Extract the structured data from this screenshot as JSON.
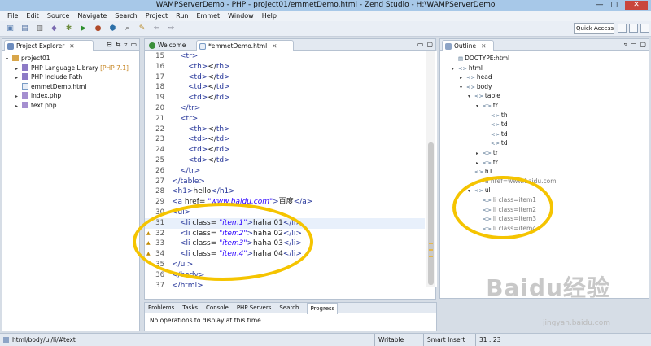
{
  "window": {
    "title": "WAMPServerDemo - PHP - project01/emmetDemo.html - Zend Studio - H:\\WAMPServerDemo"
  },
  "menu": [
    "File",
    "Edit",
    "Source",
    "Navigate",
    "Search",
    "Project",
    "Run",
    "Emmet",
    "Window",
    "Help"
  ],
  "toolbar": {
    "quick_access": "Quick Access"
  },
  "project_explorer": {
    "tab_label": "Project Explorer",
    "items": [
      {
        "label": "project01",
        "extra": ""
      },
      {
        "label": "PHP Language Library",
        "extra": "[PHP 7.1]"
      },
      {
        "label": "PHP Include Path",
        "extra": ""
      },
      {
        "label": "emmetDemo.html",
        "extra": ""
      },
      {
        "label": "index.php",
        "extra": ""
      },
      {
        "label": "text.php",
        "extra": ""
      }
    ]
  },
  "editor": {
    "tabs": [
      {
        "label": "Welcome"
      },
      {
        "label": "*emmetDemo.html"
      }
    ],
    "lines": [
      {
        "num": "15",
        "code": [
          [
            "t",
            "<tr>"
          ]
        ],
        "indent": 1
      },
      {
        "num": "16",
        "code": [
          [
            "t",
            "<th>"
          ],
          [
            "a",
            "</"
          ],
          [
            "t",
            "th>"
          ]
        ],
        "indent": 2
      },
      {
        "num": "17",
        "code": [
          [
            "t",
            "<td>"
          ],
          [
            "a",
            "</"
          ],
          [
            "t",
            "td>"
          ]
        ],
        "indent": 2
      },
      {
        "num": "18",
        "code": [
          [
            "t",
            "<td>"
          ],
          [
            "a",
            "</"
          ],
          [
            "t",
            "td>"
          ]
        ],
        "indent": 2
      },
      {
        "num": "19",
        "code": [
          [
            "t",
            "<td>"
          ],
          [
            "a",
            "</"
          ],
          [
            "t",
            "td>"
          ]
        ],
        "indent": 2
      },
      {
        "num": "20",
        "code": [
          [
            "t",
            "</tr>"
          ]
        ],
        "indent": 1
      },
      {
        "num": "21",
        "code": [
          [
            "t",
            "<tr>"
          ]
        ],
        "indent": 1
      },
      {
        "num": "22",
        "code": [
          [
            "t",
            "<th>"
          ],
          [
            "a",
            "</"
          ],
          [
            "t",
            "th>"
          ]
        ],
        "indent": 2
      },
      {
        "num": "23",
        "code": [
          [
            "t",
            "<td>"
          ],
          [
            "a",
            "</"
          ],
          [
            "t",
            "td>"
          ]
        ],
        "indent": 2
      },
      {
        "num": "24",
        "code": [
          [
            "t",
            "<td>"
          ],
          [
            "a",
            "</"
          ],
          [
            "t",
            "td>"
          ]
        ],
        "indent": 2
      },
      {
        "num": "25",
        "code": [
          [
            "t",
            "<td>"
          ],
          [
            "a",
            "</"
          ],
          [
            "t",
            "td>"
          ]
        ],
        "indent": 2
      },
      {
        "num": "26",
        "code": [
          [
            "t",
            "</tr>"
          ]
        ],
        "indent": 1
      },
      {
        "num": "27",
        "code": [
          [
            "t",
            "</table>"
          ]
        ],
        "indent": 0
      },
      {
        "num": "28",
        "code": [
          [
            "t",
            "<h1>"
          ],
          [
            "a",
            "hello"
          ],
          [
            "t",
            "</h1>"
          ]
        ],
        "indent": 0
      },
      {
        "num": "29",
        "code": [
          [
            "t",
            "<a "
          ],
          [
            "a",
            "href= "
          ],
          [
            "s",
            "\"www.baidu.com\""
          ],
          [
            "t",
            ">"
          ],
          [
            "a",
            "百度"
          ],
          [
            "t",
            "</a>"
          ]
        ],
        "indent": 0
      },
      {
        "num": "30",
        "code": [
          [
            "t",
            "<ul>"
          ]
        ],
        "indent": 0
      },
      {
        "num": "31",
        "code": [
          [
            "t",
            "<li "
          ],
          [
            "a",
            "class= "
          ],
          [
            "s",
            "\"item1\""
          ],
          [
            "t",
            ">"
          ],
          [
            "a",
            "haha 01"
          ],
          [
            "t",
            "</li>"
          ]
        ],
        "indent": 1
      },
      {
        "num": "32",
        "code": [
          [
            "t",
            "<li "
          ],
          [
            "a",
            "class= "
          ],
          [
            "s",
            "\"item2\""
          ],
          [
            "t",
            ">"
          ],
          [
            "a",
            "haha 02"
          ],
          [
            "t",
            "</li>"
          ]
        ],
        "indent": 1
      },
      {
        "num": "33",
        "code": [
          [
            "t",
            "<li "
          ],
          [
            "a",
            "class= "
          ],
          [
            "s",
            "\"item3\""
          ],
          [
            "t",
            ">"
          ],
          [
            "a",
            "haha 03"
          ],
          [
            "t",
            "</li>"
          ]
        ],
        "indent": 1
      },
      {
        "num": "34",
        "code": [
          [
            "t",
            "<li "
          ],
          [
            "a",
            "class= "
          ],
          [
            "s",
            "\"item4\""
          ],
          [
            "t",
            ">"
          ],
          [
            "a",
            "haha 04"
          ],
          [
            "t",
            "</li>"
          ]
        ],
        "indent": 1
      },
      {
        "num": "35",
        "code": [
          [
            "t",
            "</ul>"
          ]
        ],
        "indent": 0
      },
      {
        "num": "36",
        "code": [
          [
            "t",
            "</body>"
          ]
        ],
        "indent": 0
      },
      {
        "num": "37",
        "code": [
          [
            "t",
            "</html>"
          ]
        ],
        "indent": 0
      }
    ]
  },
  "outline": {
    "tab_label": "Outline",
    "items": [
      {
        "label": "DOCTYPE:html",
        "depth": 0,
        "arrow": ""
      },
      {
        "label": "html",
        "depth": 0,
        "arrow": "▾"
      },
      {
        "label": "head",
        "depth": 1,
        "arrow": "▸"
      },
      {
        "label": "body",
        "depth": 1,
        "arrow": "▾"
      },
      {
        "label": "table",
        "depth": 2,
        "arrow": "▾"
      },
      {
        "label": "tr",
        "depth": 3,
        "arrow": "▾"
      },
      {
        "label": "th",
        "depth": 4,
        "arrow": ""
      },
      {
        "label": "td",
        "depth": 4,
        "arrow": ""
      },
      {
        "label": "td",
        "depth": 4,
        "arrow": ""
      },
      {
        "label": "td",
        "depth": 4,
        "arrow": ""
      },
      {
        "label": "tr",
        "depth": 3,
        "arrow": "▸"
      },
      {
        "label": "tr",
        "depth": 3,
        "arrow": "▸"
      },
      {
        "label": "h1",
        "depth": 2,
        "arrow": ""
      },
      {
        "label": "a href=www.baidu.com",
        "depth": 2,
        "arrow": ""
      },
      {
        "label": "ul",
        "depth": 2,
        "arrow": "▾"
      },
      {
        "label": "li class=item1",
        "depth": 3,
        "arrow": ""
      },
      {
        "label": "li class=item2",
        "depth": 3,
        "arrow": ""
      },
      {
        "label": "li class=item3",
        "depth": 3,
        "arrow": ""
      },
      {
        "label": "li class=item4",
        "depth": 3,
        "arrow": ""
      }
    ]
  },
  "bottom_panel": {
    "tabs": [
      "Problems",
      "Tasks",
      "Console",
      "PHP Servers",
      "Search",
      "Progress"
    ],
    "message": "No operations to display at this time."
  },
  "status": {
    "path": "html/body/ul/li/#text",
    "mode": "Writable",
    "insert": "Smart Insert",
    "position": "31 : 23"
  },
  "watermark": {
    "brand": "Baidu经验",
    "url": "jingyan.baidu.com"
  }
}
